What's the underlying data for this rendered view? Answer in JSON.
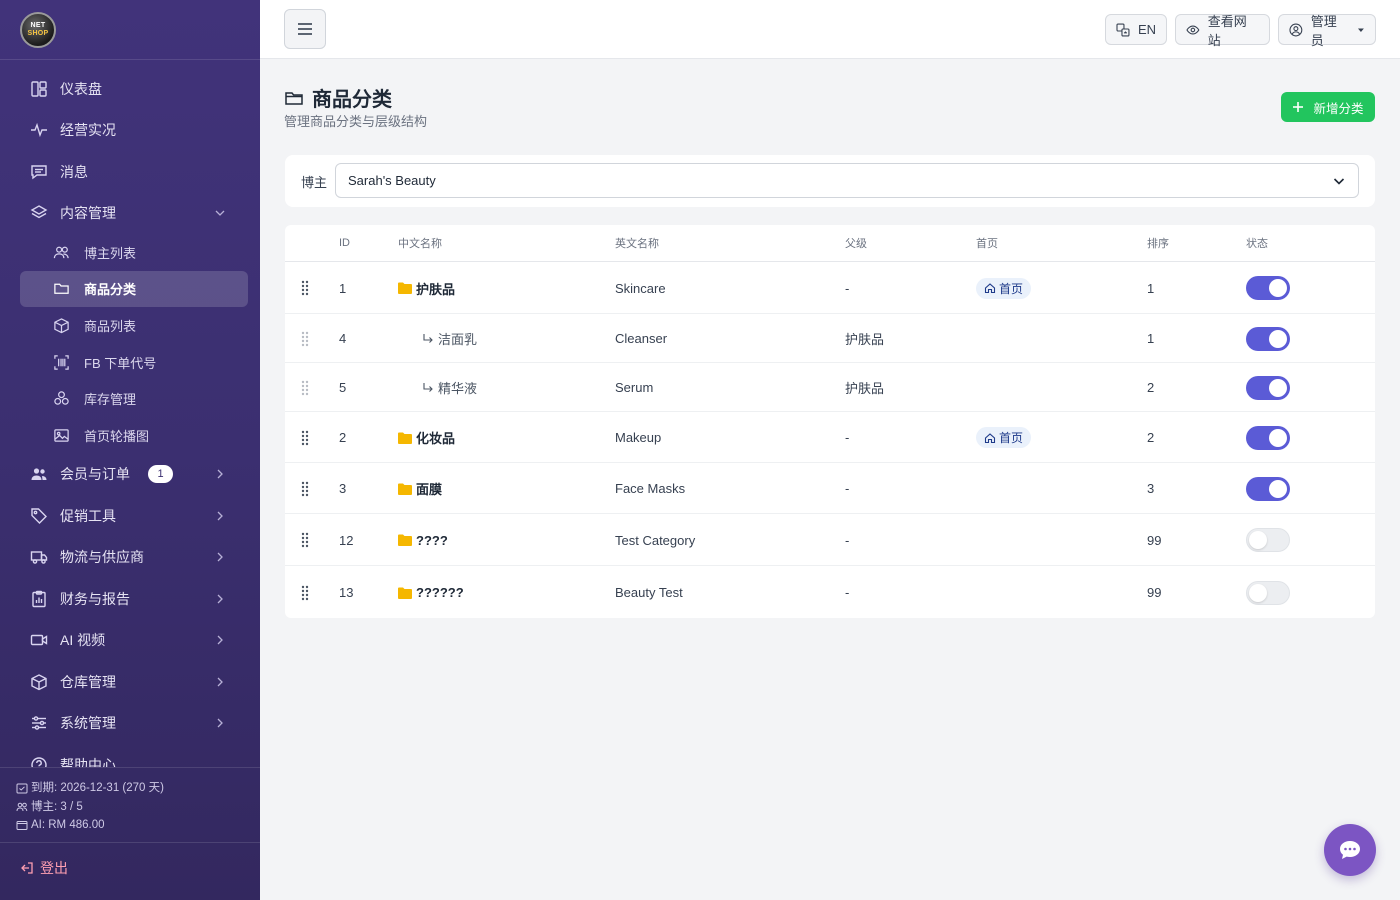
{
  "sidebar": {
    "logo": {
      "line1": "NET",
      "line2": "SHOP"
    },
    "items": [
      {
        "label": "仪表盘",
        "icon": "dashboard-icon"
      },
      {
        "label": "经营实况",
        "icon": "activity-icon"
      },
      {
        "label": "消息",
        "icon": "message-icon"
      },
      {
        "label": "内容管理",
        "icon": "layers-icon",
        "expanded": true
      }
    ],
    "content_sub": [
      {
        "label": "博主列表",
        "icon": "users-icon"
      },
      {
        "label": "商品分类",
        "icon": "folder-icon",
        "active": true
      },
      {
        "label": "商品列表",
        "icon": "box-icon"
      },
      {
        "label": "FB 下单代号",
        "icon": "barcode-icon"
      },
      {
        "label": "库存管理",
        "icon": "boxes-icon"
      },
      {
        "label": "首页轮播图",
        "icon": "image-icon"
      }
    ],
    "groups": [
      {
        "label": "会员与订单",
        "icon": "members-icon",
        "badge": "1"
      },
      {
        "label": "促销工具",
        "icon": "tag-icon"
      },
      {
        "label": "物流与供应商",
        "icon": "truck-icon"
      },
      {
        "label": "财务与报告",
        "icon": "report-icon"
      },
      {
        "label": "AI 视频",
        "icon": "video-icon"
      },
      {
        "label": "仓库管理",
        "icon": "warehouse-icon"
      },
      {
        "label": "系统管理",
        "icon": "sliders-icon"
      },
      {
        "label": "帮助中心",
        "icon": "help-icon"
      }
    ],
    "info": {
      "expiry": "到期: 2026-12-31 (270 天)",
      "bloggers": "博主: 3 / 5",
      "ai_balance": "AI: RM 486.00"
    },
    "logout": "登出"
  },
  "topbar": {
    "lang": "EN",
    "view_site": "查看网站",
    "user": "管理员"
  },
  "page": {
    "title": "商品分类",
    "subtitle": "管理商品分类与层级结构",
    "add_button": "新增分类"
  },
  "filter": {
    "label": "博主",
    "selected": "Sarah's Beauty"
  },
  "table": {
    "headers": [
      "ID",
      "中文名称",
      "英文名称",
      "父级",
      "首页",
      "排序",
      "状态"
    ],
    "home_tag": "首页",
    "rows": [
      {
        "id": "1",
        "zh": "护肤品",
        "en": "Skincare",
        "parent": "-",
        "home": true,
        "sort": "1",
        "enabled": true,
        "child": false
      },
      {
        "id": "4",
        "zh": "洁面乳",
        "en": "Cleanser",
        "parent": "护肤品",
        "home": false,
        "sort": "1",
        "enabled": true,
        "child": true
      },
      {
        "id": "5",
        "zh": "精华液",
        "en": "Serum",
        "parent": "护肤品",
        "home": false,
        "sort": "2",
        "enabled": true,
        "child": true
      },
      {
        "id": "2",
        "zh": "化妆品",
        "en": "Makeup",
        "parent": "-",
        "home": true,
        "sort": "2",
        "enabled": true,
        "child": false
      },
      {
        "id": "3",
        "zh": "面膜",
        "en": "Face Masks",
        "parent": "-",
        "home": false,
        "sort": "3",
        "enabled": true,
        "child": false
      },
      {
        "id": "12",
        "zh": "????",
        "en": "Test Category",
        "parent": "-",
        "home": false,
        "sort": "99",
        "enabled": false,
        "child": false
      },
      {
        "id": "13",
        "zh": "??????",
        "en": "Beauty Test",
        "parent": "-",
        "home": false,
        "sort": "99",
        "enabled": false,
        "child": false
      }
    ]
  },
  "colors": {
    "sidebar": "#3b2f70",
    "accent": "#5b5bd6",
    "success": "#22c55e",
    "folder": "#f5b700",
    "chat": "#7c55c3"
  }
}
